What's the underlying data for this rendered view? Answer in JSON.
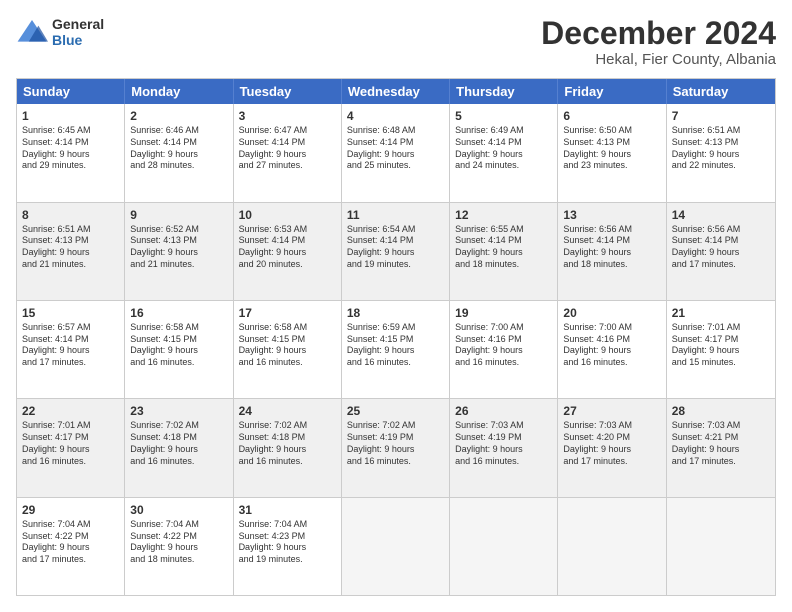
{
  "logo": {
    "general": "General",
    "blue": "Blue"
  },
  "title": "December 2024",
  "subtitle": "Hekal, Fier County, Albania",
  "header_days": [
    "Sunday",
    "Monday",
    "Tuesday",
    "Wednesday",
    "Thursday",
    "Friday",
    "Saturday"
  ],
  "weeks": [
    [
      {
        "day": "1",
        "lines": [
          "Sunrise: 6:45 AM",
          "Sunset: 4:14 PM",
          "Daylight: 9 hours",
          "and 29 minutes."
        ]
      },
      {
        "day": "2",
        "lines": [
          "Sunrise: 6:46 AM",
          "Sunset: 4:14 PM",
          "Daylight: 9 hours",
          "and 28 minutes."
        ]
      },
      {
        "day": "3",
        "lines": [
          "Sunrise: 6:47 AM",
          "Sunset: 4:14 PM",
          "Daylight: 9 hours",
          "and 27 minutes."
        ]
      },
      {
        "day": "4",
        "lines": [
          "Sunrise: 6:48 AM",
          "Sunset: 4:14 PM",
          "Daylight: 9 hours",
          "and 25 minutes."
        ]
      },
      {
        "day": "5",
        "lines": [
          "Sunrise: 6:49 AM",
          "Sunset: 4:14 PM",
          "Daylight: 9 hours",
          "and 24 minutes."
        ]
      },
      {
        "day": "6",
        "lines": [
          "Sunrise: 6:50 AM",
          "Sunset: 4:13 PM",
          "Daylight: 9 hours",
          "and 23 minutes."
        ]
      },
      {
        "day": "7",
        "lines": [
          "Sunrise: 6:51 AM",
          "Sunset: 4:13 PM",
          "Daylight: 9 hours",
          "and 22 minutes."
        ]
      }
    ],
    [
      {
        "day": "8",
        "lines": [
          "Sunrise: 6:51 AM",
          "Sunset: 4:13 PM",
          "Daylight: 9 hours",
          "and 21 minutes."
        ]
      },
      {
        "day": "9",
        "lines": [
          "Sunrise: 6:52 AM",
          "Sunset: 4:13 PM",
          "Daylight: 9 hours",
          "and 21 minutes."
        ]
      },
      {
        "day": "10",
        "lines": [
          "Sunrise: 6:53 AM",
          "Sunset: 4:14 PM",
          "Daylight: 9 hours",
          "and 20 minutes."
        ]
      },
      {
        "day": "11",
        "lines": [
          "Sunrise: 6:54 AM",
          "Sunset: 4:14 PM",
          "Daylight: 9 hours",
          "and 19 minutes."
        ]
      },
      {
        "day": "12",
        "lines": [
          "Sunrise: 6:55 AM",
          "Sunset: 4:14 PM",
          "Daylight: 9 hours",
          "and 18 minutes."
        ]
      },
      {
        "day": "13",
        "lines": [
          "Sunrise: 6:56 AM",
          "Sunset: 4:14 PM",
          "Daylight: 9 hours",
          "and 18 minutes."
        ]
      },
      {
        "day": "14",
        "lines": [
          "Sunrise: 6:56 AM",
          "Sunset: 4:14 PM",
          "Daylight: 9 hours",
          "and 17 minutes."
        ]
      }
    ],
    [
      {
        "day": "15",
        "lines": [
          "Sunrise: 6:57 AM",
          "Sunset: 4:14 PM",
          "Daylight: 9 hours",
          "and 17 minutes."
        ]
      },
      {
        "day": "16",
        "lines": [
          "Sunrise: 6:58 AM",
          "Sunset: 4:15 PM",
          "Daylight: 9 hours",
          "and 16 minutes."
        ]
      },
      {
        "day": "17",
        "lines": [
          "Sunrise: 6:58 AM",
          "Sunset: 4:15 PM",
          "Daylight: 9 hours",
          "and 16 minutes."
        ]
      },
      {
        "day": "18",
        "lines": [
          "Sunrise: 6:59 AM",
          "Sunset: 4:15 PM",
          "Daylight: 9 hours",
          "and 16 minutes."
        ]
      },
      {
        "day": "19",
        "lines": [
          "Sunrise: 7:00 AM",
          "Sunset: 4:16 PM",
          "Daylight: 9 hours",
          "and 16 minutes."
        ]
      },
      {
        "day": "20",
        "lines": [
          "Sunrise: 7:00 AM",
          "Sunset: 4:16 PM",
          "Daylight: 9 hours",
          "and 16 minutes."
        ]
      },
      {
        "day": "21",
        "lines": [
          "Sunrise: 7:01 AM",
          "Sunset: 4:17 PM",
          "Daylight: 9 hours",
          "and 15 minutes."
        ]
      }
    ],
    [
      {
        "day": "22",
        "lines": [
          "Sunrise: 7:01 AM",
          "Sunset: 4:17 PM",
          "Daylight: 9 hours",
          "and 16 minutes."
        ]
      },
      {
        "day": "23",
        "lines": [
          "Sunrise: 7:02 AM",
          "Sunset: 4:18 PM",
          "Daylight: 9 hours",
          "and 16 minutes."
        ]
      },
      {
        "day": "24",
        "lines": [
          "Sunrise: 7:02 AM",
          "Sunset: 4:18 PM",
          "Daylight: 9 hours",
          "and 16 minutes."
        ]
      },
      {
        "day": "25",
        "lines": [
          "Sunrise: 7:02 AM",
          "Sunset: 4:19 PM",
          "Daylight: 9 hours",
          "and 16 minutes."
        ]
      },
      {
        "day": "26",
        "lines": [
          "Sunrise: 7:03 AM",
          "Sunset: 4:19 PM",
          "Daylight: 9 hours",
          "and 16 minutes."
        ]
      },
      {
        "day": "27",
        "lines": [
          "Sunrise: 7:03 AM",
          "Sunset: 4:20 PM",
          "Daylight: 9 hours",
          "and 17 minutes."
        ]
      },
      {
        "day": "28",
        "lines": [
          "Sunrise: 7:03 AM",
          "Sunset: 4:21 PM",
          "Daylight: 9 hours",
          "and 17 minutes."
        ]
      }
    ],
    [
      {
        "day": "29",
        "lines": [
          "Sunrise: 7:04 AM",
          "Sunset: 4:22 PM",
          "Daylight: 9 hours",
          "and 17 minutes."
        ]
      },
      {
        "day": "30",
        "lines": [
          "Sunrise: 7:04 AM",
          "Sunset: 4:22 PM",
          "Daylight: 9 hours",
          "and 18 minutes."
        ]
      },
      {
        "day": "31",
        "lines": [
          "Sunrise: 7:04 AM",
          "Sunset: 4:23 PM",
          "Daylight: 9 hours",
          "and 19 minutes."
        ]
      },
      {
        "day": "",
        "lines": []
      },
      {
        "day": "",
        "lines": []
      },
      {
        "day": "",
        "lines": []
      },
      {
        "day": "",
        "lines": []
      }
    ]
  ]
}
